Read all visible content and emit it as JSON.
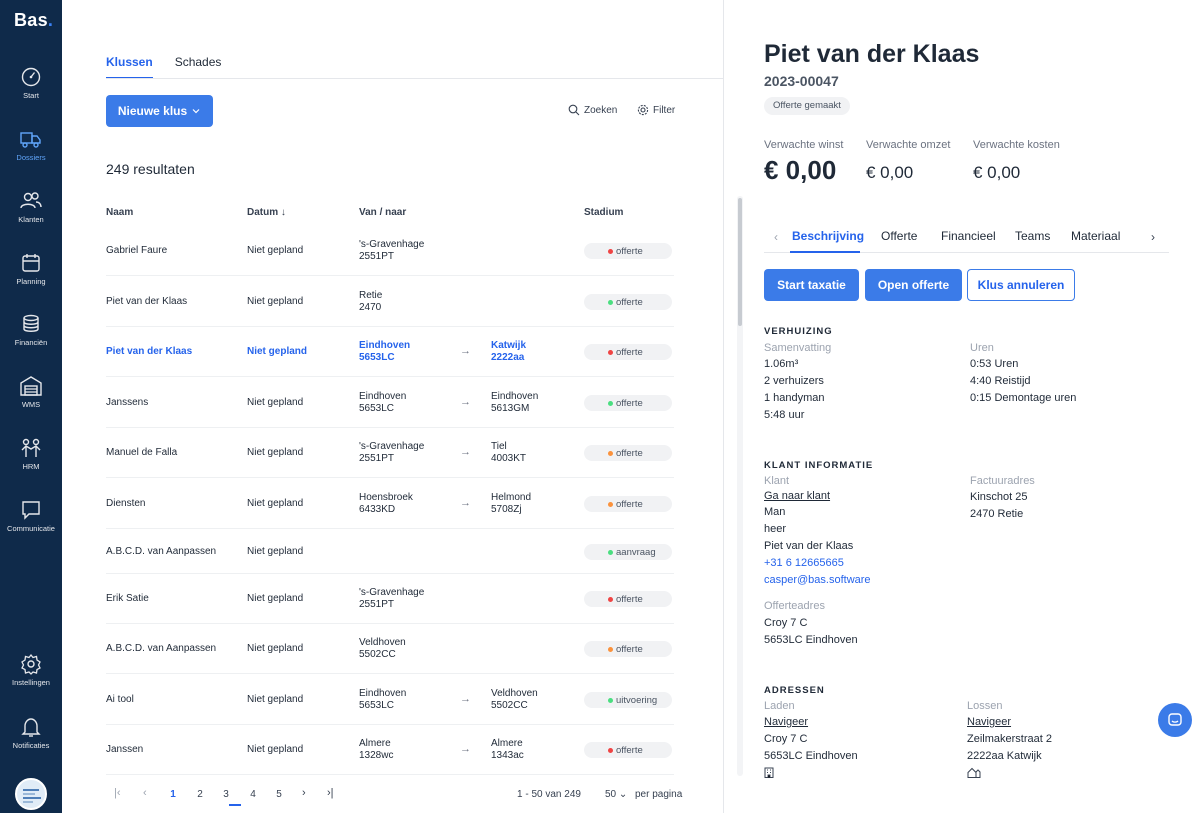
{
  "app": {
    "logo": "Bas",
    "logo_dot": "."
  },
  "nav": [
    {
      "label": "Start",
      "icon": "gauge-icon",
      "active": false
    },
    {
      "label": "Dossiers",
      "icon": "truck-icon",
      "active": true
    },
    {
      "label": "Klanten",
      "icon": "users-icon",
      "active": false
    },
    {
      "label": "Planning",
      "icon": "calendar-icon",
      "active": false
    },
    {
      "label": "Financiën",
      "icon": "coins-icon",
      "active": false
    },
    {
      "label": "WMS",
      "icon": "warehouse-icon",
      "active": false
    },
    {
      "label": "HRM",
      "icon": "team-icon",
      "active": false
    },
    {
      "label": "Communicatie",
      "icon": "chat-icon",
      "active": false
    },
    {
      "label": "Instellingen",
      "icon": "gear-icon",
      "active": false
    },
    {
      "label": "Notificaties",
      "icon": "bell-icon",
      "active": false
    }
  ],
  "main": {
    "tabs": [
      "Klussen",
      "Schades"
    ],
    "new_button": "Nieuwe klus",
    "search_label": "Zoeken",
    "filter_label": "Filter",
    "results": "249 resultaten",
    "columns": {
      "name": "Naam",
      "date": "Datum",
      "route": "Van / naar",
      "stage": "Stadium"
    },
    "rows": [
      {
        "name": "Gabriel Faure",
        "date": "Niet gepland",
        "from_city": "'s-Gravenhage",
        "from_zip": "2551PT",
        "to_city": "",
        "to_zip": "",
        "stage": "offerte",
        "dot": "#ef4444",
        "highlight": false
      },
      {
        "name": "Piet van der Klaas",
        "date": "Niet gepland",
        "from_city": "Retie",
        "from_zip": "2470",
        "to_city": "",
        "to_zip": "",
        "stage": "offerte",
        "dot": "#4ade80",
        "highlight": false
      },
      {
        "name": "Piet van der Klaas",
        "date": "Niet gepland",
        "from_city": "Eindhoven",
        "from_zip": "5653LC",
        "to_city": "Katwijk",
        "to_zip": "2222aa",
        "stage": "offerte",
        "dot": "#ef4444",
        "highlight": true
      },
      {
        "name": "Janssens",
        "date": "Niet gepland",
        "from_city": "Eindhoven",
        "from_zip": "5653LC",
        "to_city": "Eindhoven",
        "to_zip": "5613GM",
        "stage": "offerte",
        "dot": "#4ade80",
        "highlight": false
      },
      {
        "name": "Manuel de Falla",
        "date": "Niet gepland",
        "from_city": "'s-Gravenhage",
        "from_zip": "2551PT",
        "to_city": "Tiel",
        "to_zip": "4003KT",
        "stage": "offerte",
        "dot": "#fb923c",
        "highlight": false
      },
      {
        "name": "Diensten",
        "date": "Niet gepland",
        "from_city": "Hoensbroek",
        "from_zip": "6433KD",
        "to_city": "Helmond",
        "to_zip": "5708Zj",
        "stage": "offerte",
        "dot": "#fb923c",
        "highlight": false
      },
      {
        "name": "A.B.C.D. van Aanpassen",
        "date": "Niet gepland",
        "from_city": "",
        "from_zip": "",
        "to_city": "",
        "to_zip": "",
        "stage": "aanvraag",
        "dot": "#4ade80",
        "highlight": false
      },
      {
        "name": "Erik Satie",
        "date": "Niet gepland",
        "from_city": "'s-Gravenhage",
        "from_zip": "2551PT",
        "to_city": "",
        "to_zip": "",
        "stage": "offerte",
        "dot": "#ef4444",
        "highlight": false
      },
      {
        "name": "A.B.C.D. van Aanpassen",
        "date": "Niet gepland",
        "from_city": "Veldhoven",
        "from_zip": "5502CC",
        "to_city": "",
        "to_zip": "",
        "stage": "offerte",
        "dot": "#fb923c",
        "highlight": false
      },
      {
        "name": "Ai tool",
        "date": "Niet gepland",
        "from_city": "Eindhoven",
        "from_zip": "5653LC",
        "to_city": "Veldhoven",
        "to_zip": "5502CC",
        "stage": "uitvoering",
        "dot": "#4ade80",
        "highlight": false
      },
      {
        "name": "Janssen",
        "date": "Niet gepland",
        "from_city": "Almere",
        "from_zip": "1328wc",
        "to_city": "Almere",
        "to_zip": "1343ac",
        "stage": "offerte",
        "dot": "#ef4444",
        "highlight": false
      }
    ],
    "pagination": {
      "pages": [
        "1",
        "2",
        "3",
        "4",
        "5"
      ],
      "current": "1",
      "range": "1 - 50 van 249",
      "per_page": "50",
      "per_page_label": "per pagina"
    }
  },
  "detail": {
    "name": "Piet van der Klaas",
    "number": "2023-00047",
    "status": "Offerte gemaakt",
    "metrics": [
      {
        "label": "Verwachte winst",
        "value": "€ 0,00"
      },
      {
        "label": "Verwachte omzet",
        "value": "€ 0,00"
      },
      {
        "label": "Verwachte kosten",
        "value": "€ 0,00"
      }
    ],
    "tabs": [
      "Beschrijving",
      "Offerte",
      "Financieel",
      "Teams",
      "Materiaal"
    ],
    "actions": {
      "start": "Start taxatie",
      "open": "Open offerte",
      "cancel": "Klus annuleren"
    },
    "move": {
      "title": "VERHUIZING",
      "summary_label": "Samenvatting",
      "summary": [
        "1.06m³",
        "2 verhuizers",
        "1 handyman",
        "5:48 uur"
      ],
      "hours_label": "Uren",
      "hours": [
        "0:53 Uren",
        "4:40 Reistijd",
        "0:15 Demontage uren"
      ]
    },
    "client": {
      "title": "KLANT INFORMATIE",
      "client_label": "Klant",
      "go_to": "Ga naar klant",
      "gender": "Man",
      "salutation": "heer",
      "name": "Piet van der Klaas",
      "phone": "+31 6 12665665",
      "email": "casper@bas.software",
      "invoice_label": "Factuuradres",
      "invoice_street": "Kinschot 25",
      "invoice_city": "2470 Retie",
      "quote_label": "Offerteadres",
      "quote_street": "Croy 7 C",
      "quote_city": "5653LC Eindhoven"
    },
    "addresses": {
      "title": "ADRESSEN",
      "load_label": "Laden",
      "load_nav": "Navigeer",
      "load_street": "Croy 7 C",
      "load_city": "5653LC Eindhoven",
      "unload_label": "Lossen",
      "unload_nav": "Navigeer",
      "unload_street": "Zeilmakerstraat 2",
      "unload_city": "2222aa Katwijk"
    }
  }
}
